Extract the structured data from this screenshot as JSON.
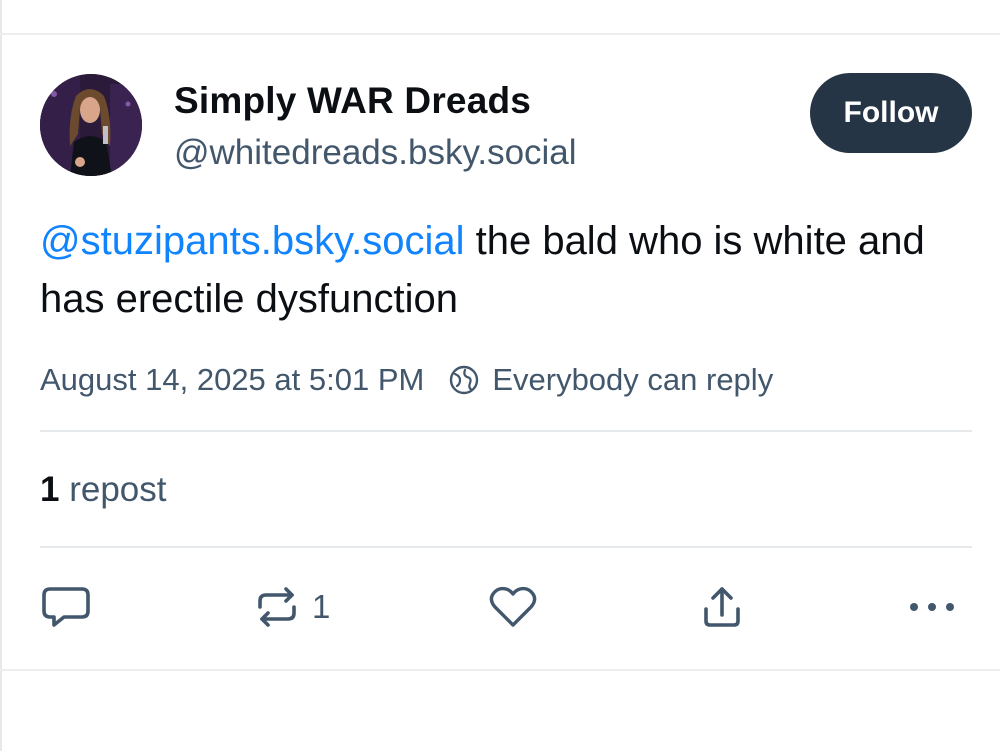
{
  "author": {
    "display_name": "Simply WAR Dreads",
    "handle": "@whitedreads.bsky.social"
  },
  "follow_label": "Follow",
  "post": {
    "mention": "@stuzipants.bsky.social",
    "text": " the bald who is white and has erectile dysfunction"
  },
  "meta": {
    "timestamp": "August 14, 2025 at 5:01 PM",
    "reply_setting": "Everybody can reply"
  },
  "stats": {
    "repost_count": "1",
    "repost_label": "repost"
  },
  "actions": {
    "reply_icon": "reply-icon",
    "repost_icon": "repost-icon",
    "repost_count": "1",
    "like_icon": "heart-icon",
    "share_icon": "share-icon",
    "more_icon": "more-icon"
  },
  "colors": {
    "accent_link": "#1083fe",
    "follow_button": "#263545",
    "muted_text": "#42576c"
  }
}
